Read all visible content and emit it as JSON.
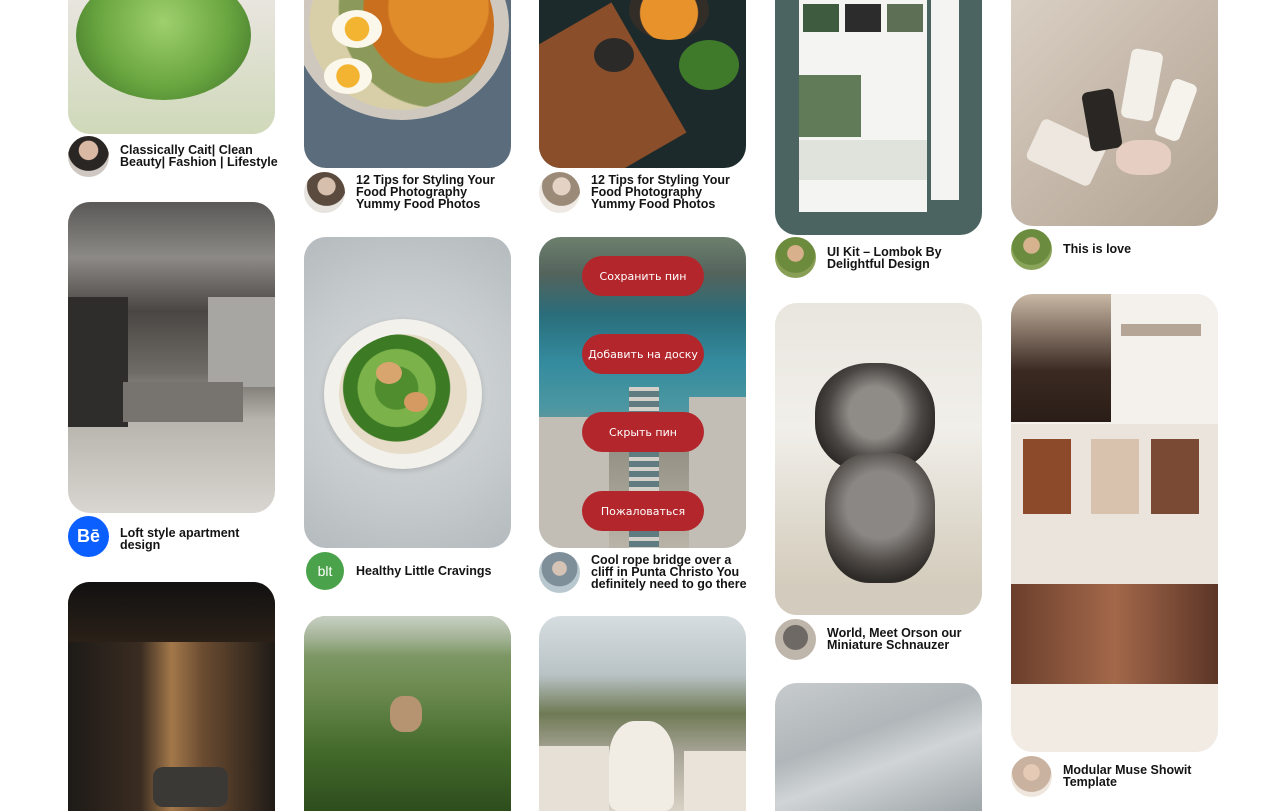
{
  "pins": [
    {
      "id": "cait",
      "title": "Classically Cait| Clean Beauty| Fashion | Lifestyle"
    },
    {
      "id": "loft",
      "title": "Loft style apartment design",
      "avatar_text": "Bē"
    },
    {
      "id": "bath",
      "title": ""
    },
    {
      "id": "bowl",
      "title": "12 Tips for Styling Your Food Photography Yummy Food Photos"
    },
    {
      "id": "salad",
      "title": "Healthy Little Cravings",
      "avatar_text": "blt"
    },
    {
      "id": "swing",
      "title": ""
    },
    {
      "id": "board",
      "title": "12 Tips for Styling Your Food Photography Yummy Food Photos"
    },
    {
      "id": "bridge",
      "title": "Cool rope bridge over a cliff in Punta Christo You definitely need to go there"
    },
    {
      "id": "alpaca",
      "title": ""
    },
    {
      "id": "uikit",
      "title": "UI Kit – Lombok By Delightful Design"
    },
    {
      "id": "dog",
      "title": "World, Meet Orson our Miniature Schnauzer"
    },
    {
      "id": "sky",
      "title": ""
    },
    {
      "id": "love",
      "title": "This is love"
    },
    {
      "id": "muse",
      "title": "Modular Muse Showit Template"
    }
  ],
  "overlay_menu": {
    "save": "Сохранить пин",
    "add": "Добавить на доску",
    "hide": "Скрыть пин",
    "report": "Пожаловаться"
  },
  "colors": {
    "accent": "#b3262b"
  }
}
